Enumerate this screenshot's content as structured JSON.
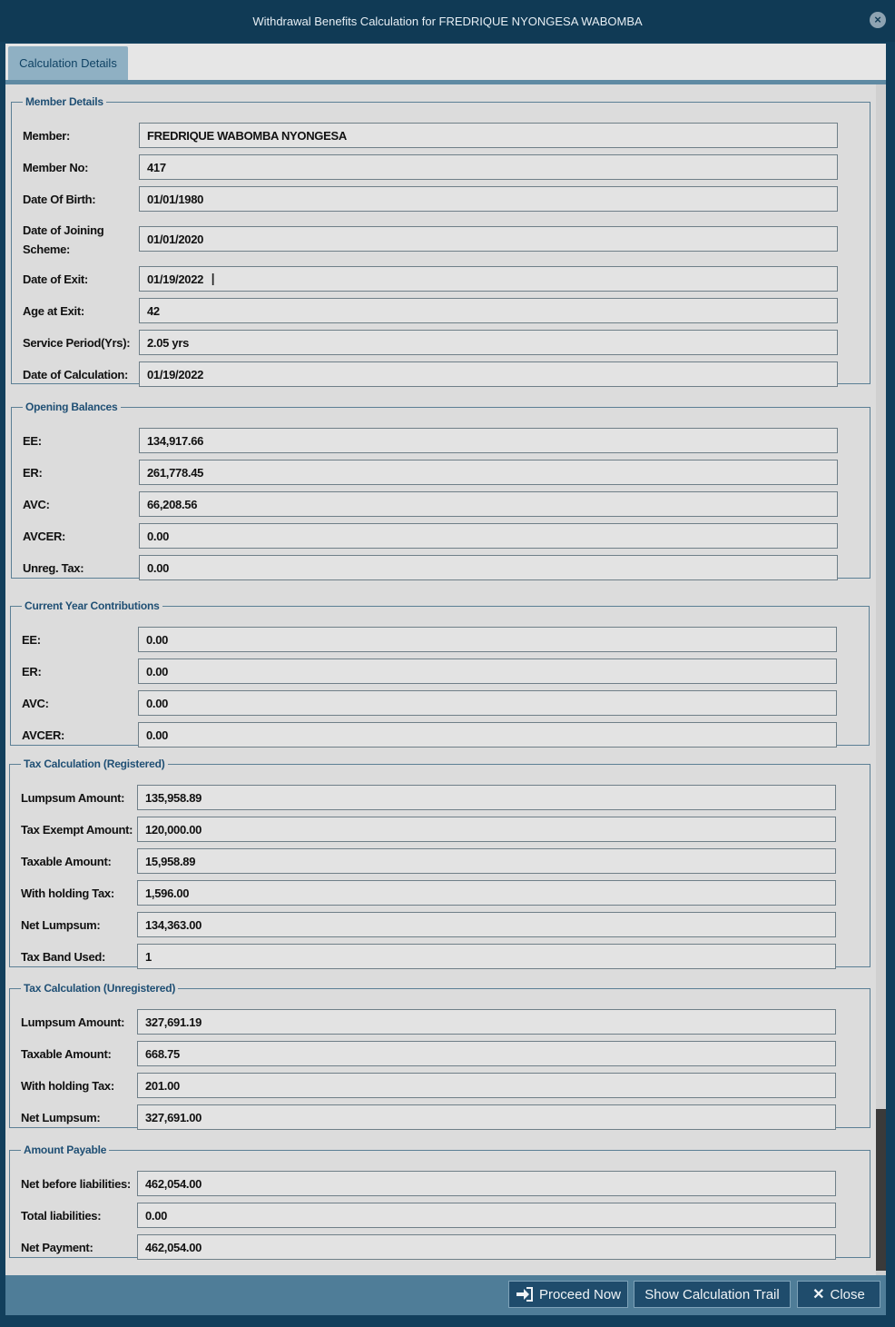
{
  "window": {
    "title": "Withdrawal Benefits Calculation for FREDRIQUE NYONGESA WABOMBA"
  },
  "tabs": [
    {
      "label": "Calculation Details"
    }
  ],
  "sections": {
    "member": {
      "legend": "Member Details",
      "fields": [
        {
          "label": "Member:",
          "value": "FREDRIQUE WABOMBA NYONGESA"
        },
        {
          "label": "Member No:",
          "value": "417"
        },
        {
          "label": "Date Of Birth:",
          "value": "01/01/1980"
        },
        {
          "label": "Date of Joining Scheme:",
          "value": "01/01/2020"
        },
        {
          "label": "Date of Exit:",
          "value": "01/19/2022"
        },
        {
          "label": "Age at Exit:",
          "value": "42"
        },
        {
          "label": "Service Period(Yrs):",
          "value": "2.05 yrs"
        },
        {
          "label": "Date of Calculation:",
          "value": "01/19/2022"
        }
      ]
    },
    "opening": {
      "legend": "Opening Balances",
      "fields": [
        {
          "label": "EE:",
          "value": "134,917.66"
        },
        {
          "label": "ER:",
          "value": "261,778.45"
        },
        {
          "label": "AVC:",
          "value": "66,208.56"
        },
        {
          "label": "AVCER:",
          "value": "0.00"
        },
        {
          "label": "Unreg. Tax:",
          "value": "0.00"
        }
      ]
    },
    "current": {
      "legend": "Current Year Contributions",
      "fields": [
        {
          "label": "EE:",
          "value": "0.00"
        },
        {
          "label": "ER:",
          "value": "0.00"
        },
        {
          "label": "AVC:",
          "value": "0.00"
        },
        {
          "label": "AVCER:",
          "value": "0.00"
        }
      ]
    },
    "taxreg": {
      "legend": "Tax Calculation (Registered)",
      "fields": [
        {
          "label": "Lumpsum Amount:",
          "value": "135,958.89"
        },
        {
          "label": "Tax Exempt Amount:",
          "value": "120,000.00"
        },
        {
          "label": "Taxable Amount:",
          "value": "15,958.89"
        },
        {
          "label": "With holding Tax:",
          "value": "1,596.00"
        },
        {
          "label": "Net Lumpsum:",
          "value": "134,363.00"
        },
        {
          "label": "Tax Band Used:",
          "value": "1"
        }
      ]
    },
    "taxunreg": {
      "legend": "Tax Calculation (Unregistered)",
      "fields": [
        {
          "label": "Lumpsum Amount:",
          "value": "327,691.19"
        },
        {
          "label": "Taxable Amount:",
          "value": "668.75"
        },
        {
          "label": "With holding Tax:",
          "value": "201.00"
        },
        {
          "label": "Net Lumpsum:",
          "value": "327,691.00"
        }
      ]
    },
    "payable": {
      "legend": "Amount Payable",
      "fields": [
        {
          "label": "Net before liabilities:",
          "value": "462,054.00"
        },
        {
          "label": "Total liabilities:",
          "value": "0.00"
        },
        {
          "label": "Net Payment:",
          "value": "462,054.00"
        }
      ]
    }
  },
  "buttons": {
    "proceed": "Proceed Now",
    "trail": "Show Calculation Trail",
    "close": "Close"
  }
}
